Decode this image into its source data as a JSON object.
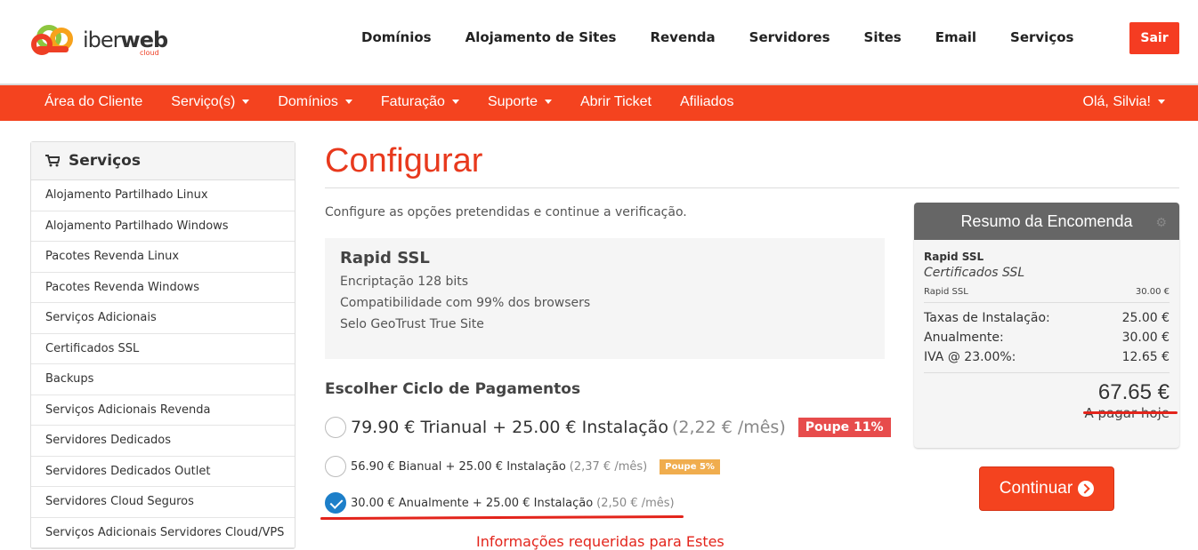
{
  "brand": {
    "name_prefix": "iber",
    "name_bold": "web",
    "sub": "cloud",
    "accent": "#f4431f"
  },
  "topnav": [
    "Domínios",
    "Alojamento de Sites",
    "Revenda",
    "Servidores",
    "Sites",
    "Email",
    "Serviços"
  ],
  "logout_label": "Sair",
  "rednav": {
    "items": [
      {
        "label": "Área do Cliente",
        "dropdown": false
      },
      {
        "label": "Serviço(s)",
        "dropdown": true
      },
      {
        "label": "Domínios",
        "dropdown": true
      },
      {
        "label": "Faturação",
        "dropdown": true
      },
      {
        "label": "Suporte",
        "dropdown": true
      },
      {
        "label": "Abrir Ticket",
        "dropdown": false
      },
      {
        "label": "Afiliados",
        "dropdown": false
      }
    ],
    "greeting": "Olá, Silvia!"
  },
  "sidebar": {
    "title": "Serviços",
    "items": [
      "Alojamento Partilhado Linux",
      "Alojamento Partilhado Windows",
      "Pacotes Revenda Linux",
      "Pacotes Revenda Windows",
      "Serviços Adicionais",
      "Certificados SSL",
      "Backups",
      "Serviços Adicionais Revenda",
      "Servidores Dedicados",
      "Servidores Dedicados Outlet",
      "Servidores Cloud Seguros",
      "Serviços Adicionais Servidores Cloud/VPS"
    ]
  },
  "main": {
    "title": "Configurar",
    "intro": "Configure as opções pretendidas e continue a verificação.",
    "product": {
      "name": "Rapid SSL",
      "features": [
        "Encriptação 128 bits",
        "Compatibilidade com 99% dos browsers",
        "Selo GeoTrust True Site"
      ]
    },
    "cycle_title": "Escolher Ciclo de Pagamentos",
    "options": [
      {
        "text": "79.90 € Trianual + 25.00 € Instalação",
        "monthly": "(2,22 € /mês)",
        "badge": "Poupe 11%",
        "checked": false
      },
      {
        "text": "56.90 € Bianual + 25.00 € Instalação",
        "monthly": "(2,37 € /mês)",
        "badge": "Poupe 5%",
        "checked": false
      },
      {
        "text": "30.00 € Anualmente + 25.00 € Instalação",
        "monthly": "(2,50 € /mês)",
        "badge": "",
        "checked": true
      }
    ],
    "partial_text": "Informações requeridas para Estes"
  },
  "summary": {
    "title": "Resumo da Encomenda",
    "product": "Rapid SSL",
    "category": "Certificados SSL",
    "line": {
      "label": "Rapid SSL",
      "value": "30.00 €"
    },
    "rows": [
      {
        "label": "Taxas de Instalação:",
        "value": "25.00 €"
      },
      {
        "label": "Anualmente:",
        "value": "30.00 €"
      },
      {
        "label": "IVA @ 23.00%:",
        "value": "12.65 €"
      }
    ],
    "total": "67.65 €",
    "due": "A pagar hoje"
  },
  "continue_label": "Continuar"
}
